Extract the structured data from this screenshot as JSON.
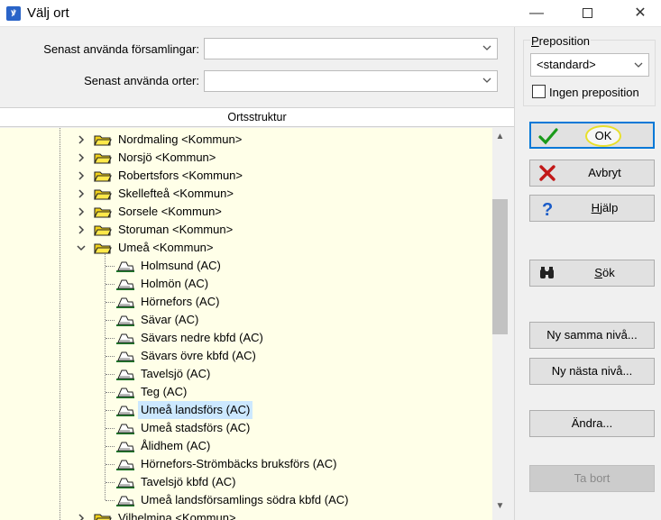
{
  "window": {
    "title": "Välj ort",
    "app_icon": "app-icon"
  },
  "form": {
    "recent_parishes_label": "Senast använda församlingar:",
    "recent_parishes_value": "",
    "recent_places_label": "Senast använda orter:",
    "recent_places_value": ""
  },
  "tree": {
    "header": "Ortsstruktur",
    "kommuner": [
      {
        "label": "Nordmaling <Kommun>",
        "expanded": false
      },
      {
        "label": "Norsjö <Kommun>",
        "expanded": false
      },
      {
        "label": "Robertsfors <Kommun>",
        "expanded": false
      },
      {
        "label": "Skellefteå <Kommun>",
        "expanded": false
      },
      {
        "label": "Sorsele <Kommun>",
        "expanded": false
      },
      {
        "label": "Storuman <Kommun>",
        "expanded": false
      },
      {
        "label": "Umeå <Kommun>",
        "expanded": true
      }
    ],
    "children": [
      "Holmsund (AC)",
      "Holmön (AC)",
      "Hörnefors (AC)",
      "Sävar (AC)",
      "Sävars nedre kbfd (AC)",
      "Sävars övre kbfd (AC)",
      "Tavelsjö (AC)",
      "Teg (AC)",
      "Umeå landsförs (AC)",
      "Umeå stadsförs (AC)",
      "Ålidhem (AC)",
      "Hörnefors-Strömbäcks bruksförs (AC)",
      "Tavelsjö kbfd (AC)",
      "Umeå landsförsamlings södra kbfd (AC)"
    ],
    "selected_child": "Umeå landsförs (AC)",
    "partial_last": "Vilhelmina <Kommun>"
  },
  "preposition": {
    "group_label": "Preposition",
    "selected": "<standard>",
    "no_preposition_label": "Ingen preposition",
    "no_preposition_checked": false
  },
  "buttons": {
    "ok": "OK",
    "cancel": "Avbryt",
    "help": "Hjälp",
    "search": "Sök",
    "new_same_level": "Ny samma nivå...",
    "new_next_level": "Ny nästa nivå...",
    "edit": "Ändra...",
    "delete": "Ta bort"
  },
  "colors": {
    "tree_bg": "#ffffe8",
    "selection": "#cce8ff",
    "accent": "#0078d7",
    "ok_highlight": "#e8e02a"
  }
}
